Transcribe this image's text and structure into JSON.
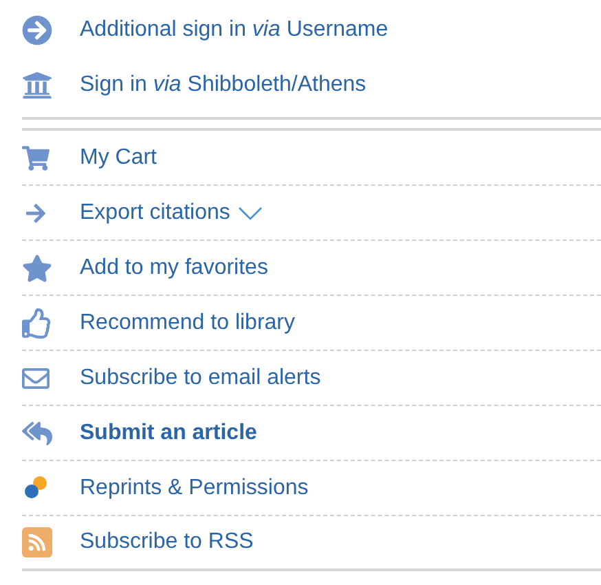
{
  "sign_in_links": [
    {
      "kind": "arrow",
      "label": "Additional sign in *via* Username"
    },
    {
      "kind": "institution",
      "label": "Sign in *via* Shibboleth/Athens"
    }
  ],
  "actions": [
    {
      "kind": "cart",
      "label": "My Cart",
      "bold": false,
      "has_menu": false
    },
    {
      "kind": "export",
      "label": "Export citations",
      "bold": false,
      "has_menu": true
    },
    {
      "kind": "favorite",
      "label": "Add to my favorites",
      "bold": false,
      "has_menu": false
    },
    {
      "kind": "recommend",
      "label": "Recommend to library",
      "bold": false,
      "has_menu": false
    },
    {
      "kind": "email",
      "label": "Subscribe to email alerts",
      "bold": false,
      "has_menu": false
    },
    {
      "kind": "submit",
      "label": "Submit an article",
      "bold": true,
      "has_menu": false
    },
    {
      "kind": "reprints",
      "label": "Reprints & Permissions",
      "bold": false,
      "has_menu": false
    },
    {
      "kind": "rss",
      "label": "Subscribe to RSS",
      "bold": false,
      "has_menu": false
    }
  ]
}
